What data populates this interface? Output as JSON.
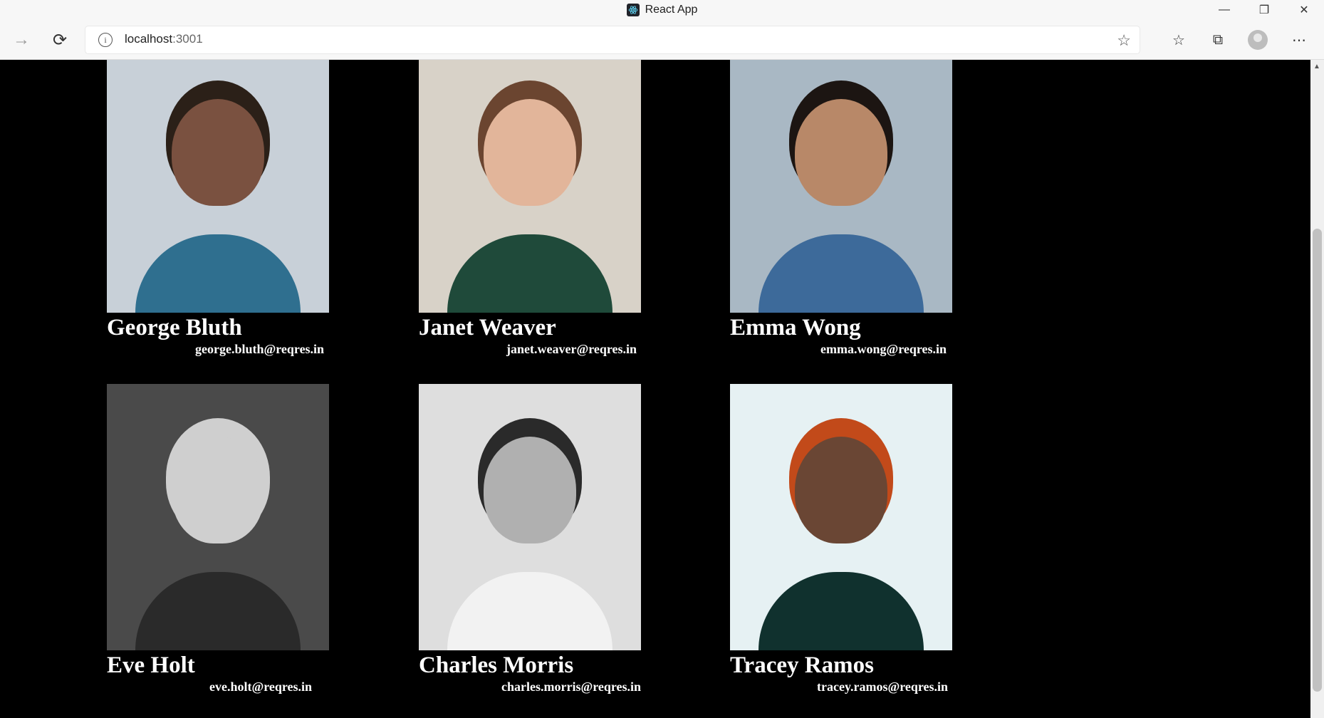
{
  "window": {
    "title": "React App"
  },
  "browser": {
    "url_host": "localhost",
    "url_port": ":3001"
  },
  "users": [
    {
      "name": "George Bluth",
      "email": "george.bluth@reqres.in",
      "bg": "#c8d0d8",
      "skin": "#7a5140",
      "shirt": "#2f6f8f",
      "hair": "#2b2018"
    },
    {
      "name": "Janet Weaver",
      "email": "janet.weaver@reqres.in",
      "bg": "#d8d2c8",
      "skin": "#e2b59a",
      "shirt": "#1f4a3a",
      "hair": "#6b4530"
    },
    {
      "name": "Emma Wong",
      "email": "emma.wong@reqres.in",
      "bg": "#a9b8c4",
      "skin": "#b88868",
      "shirt": "#3d6a9a",
      "hair": "#1c1512"
    },
    {
      "name": "Eve Holt",
      "email": "eve.holt@reqres.in",
      "bg": "#4a4a4a",
      "skin": "#cfcfcf",
      "shirt": "#2a2a2a",
      "hair": "#cfcfcf"
    },
    {
      "name": "Charles Morris",
      "email": "charles.morris@reqres.in",
      "bg": "#dedede",
      "skin": "#b0b0b0",
      "shirt": "#f2f2f2",
      "hair": "#2a2a2a"
    },
    {
      "name": "Tracey Ramos",
      "email": "tracey.ramos@reqres.in",
      "bg": "#e6f1f3",
      "skin": "#6a4634",
      "shirt": "#10312e",
      "hair": "#c24a1a"
    }
  ]
}
